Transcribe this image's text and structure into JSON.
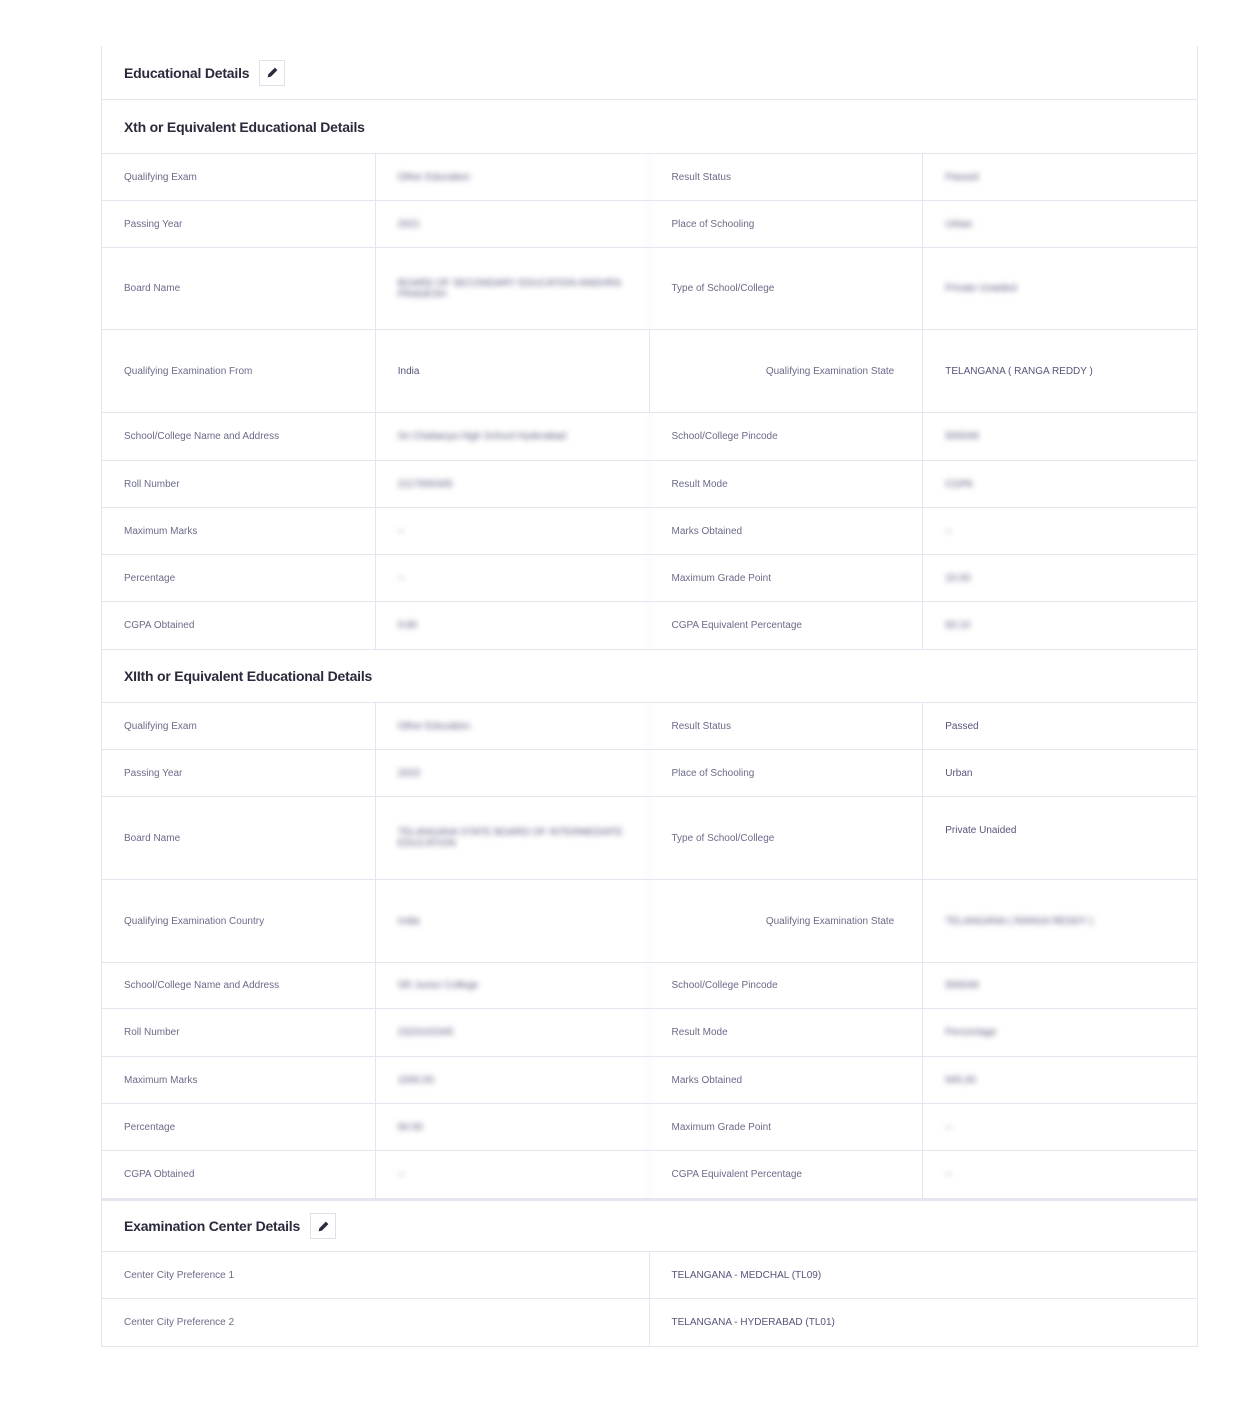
{
  "educational": {
    "title": "Educational Details",
    "tenth": {
      "title": "Xth or Equivalent Educational Details",
      "rows": [
        {
          "l1": "Qualifying Exam",
          "v1": "Other Education",
          "l2": "Result Status",
          "v2": "Passed"
        },
        {
          "l1": "Passing Year",
          "v1": "2021",
          "l2": "Place of Schooling",
          "v2": "Urban"
        },
        {
          "l1": "Board Name",
          "v1": "BOARD OF SECONDARY EDUCATION ANDHRA PRADESH",
          "l2": "Type of School/College",
          "v2": "Private Unaided"
        },
        {
          "l1": "Qualifying Examination From",
          "v1": "India",
          "l2": "Qualifying Examination State",
          "v2": "TELANGANA ( RANGA REDDY )"
        },
        {
          "l1": "School/College Name and Address",
          "v1": "Sri Chaitanya High School Hyderabad",
          "l2": "School/College Pincode",
          "v2": "500049"
        },
        {
          "l1": "Roll Number",
          "v1": "2117600345",
          "l2": "Result Mode",
          "v2": "CGPA"
        },
        {
          "l1": "Maximum Marks",
          "v1": "--",
          "l2": "Marks Obtained",
          "v2": "--"
        },
        {
          "l1": "Percentage",
          "v1": "--",
          "l2": "Maximum Grade Point",
          "v2": "10.00"
        },
        {
          "l1": "CGPA Obtained",
          "v1": "9.80",
          "l2": "CGPA Equivalent Percentage",
          "v2": "93.10"
        }
      ]
    },
    "twelfth": {
      "title": "XIIth or Equivalent Educational Details",
      "rows": [
        {
          "l1": "Qualifying Exam",
          "v1": "Other Education",
          "l2": "Result Status",
          "v2": "Passed"
        },
        {
          "l1": "Passing Year",
          "v1": "2023",
          "l2": "Place of Schooling",
          "v2": "Urban"
        },
        {
          "l1": "Board Name",
          "v1": "TELANGANA STATE BOARD OF INTERMEDIATE EDUCATION",
          "l2": "Type of School/College",
          "v2": "Private Unaided"
        },
        {
          "l1": "Qualifying Examination Country",
          "v1": "India",
          "l2": "Qualifying Examination State",
          "v2": "TELANGANA ( RANGA REDDY )"
        },
        {
          "l1": "School/College Name and Address",
          "v1": "SR Junior College",
          "l2": "School/College Pincode",
          "v2": "500049"
        },
        {
          "l1": "Roll Number",
          "v1": "2323102345",
          "l2": "Result Mode",
          "v2": "Percentage"
        },
        {
          "l1": "Maximum Marks",
          "v1": "1000.00",
          "l2": "Marks Obtained",
          "v2": "945.00"
        },
        {
          "l1": "Percentage",
          "v1": "94.50",
          "l2": "Maximum Grade Point",
          "v2": "--"
        },
        {
          "l1": "CGPA Obtained",
          "v1": "--",
          "l2": "CGPA Equivalent Percentage",
          "v2": "--"
        }
      ]
    }
  },
  "exam_center": {
    "title": "Examination Center Details",
    "rows": [
      {
        "label": "Center City Preference 1",
        "value": "TELANGANA - MEDCHAL (TL09)"
      },
      {
        "label": "Center City Preference 2",
        "value": "TELANGANA - HYDERABAD (TL01)"
      }
    ]
  },
  "icons": {
    "edit": "pencil-icon"
  }
}
